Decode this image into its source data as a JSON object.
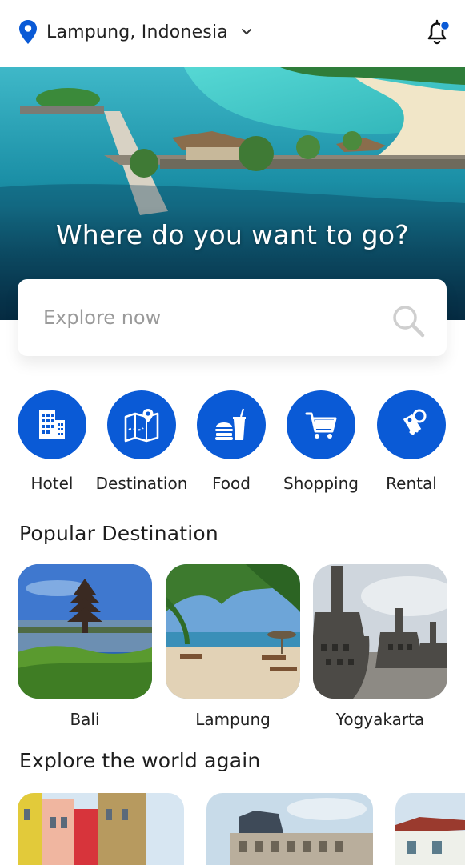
{
  "header": {
    "location": "Lampung, Indonesia",
    "icons": [
      "location-pin-icon",
      "chevron-down-icon",
      "bell-icon"
    ],
    "notification_dot_color": "#0a5ad6"
  },
  "hero": {
    "title": "Where do you want to go?"
  },
  "search": {
    "placeholder": "Explore now"
  },
  "categories": [
    {
      "label": "Hotel",
      "icon": "hotel-icon"
    },
    {
      "label": "Destination",
      "icon": "map-icon"
    },
    {
      "label": "Food",
      "icon": "food-icon"
    },
    {
      "label": "Shopping",
      "icon": "cart-icon"
    },
    {
      "label": "Rental",
      "icon": "keys-icon"
    }
  ],
  "popular": {
    "title": "Popular Destination",
    "items": [
      {
        "name": "Bali"
      },
      {
        "name": "Lampung"
      },
      {
        "name": "Yogyakarta"
      }
    ]
  },
  "explore": {
    "title": "Explore the world again"
  },
  "colors": {
    "accent": "#0a5ad6",
    "text": "#1e1e1e"
  }
}
